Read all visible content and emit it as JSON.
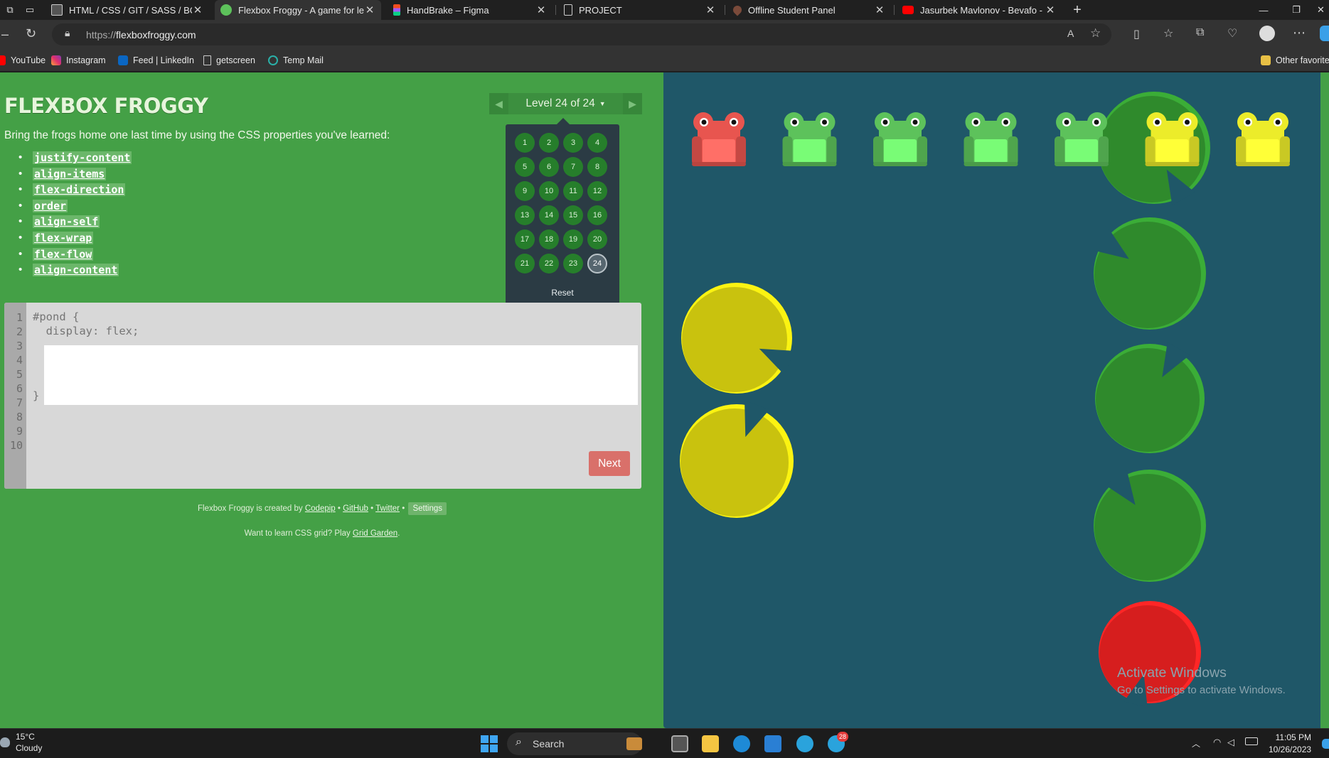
{
  "browser": {
    "tabs": [
      {
        "title": "HTML / CSS / GIT / SASS / BOOT",
        "icon": "notion-icon",
        "active": false
      },
      {
        "title": "Flexbox Froggy - A game for lear",
        "icon": "frog-icon",
        "active": true
      },
      {
        "title": "HandBrake – Figma",
        "icon": "figma-icon",
        "active": false
      },
      {
        "title": "PROJECT",
        "icon": "page-icon",
        "active": false
      },
      {
        "title": "Offline Student Panel",
        "icon": "heart-icon",
        "active": false
      },
      {
        "title": "Jasurbek Mavlonov - Bevafo - Yo",
        "icon": "youtube-icon",
        "active": false
      }
    ],
    "url_prefix": "https://",
    "url_host": "flexboxfroggy.com",
    "bookmarks": [
      {
        "label": "YouTube",
        "icon": "youtube-icon"
      },
      {
        "label": "Instagram",
        "icon": "instagram-icon"
      },
      {
        "label": "Feed | LinkedIn",
        "icon": "linkedin-icon"
      },
      {
        "label": "getscreen",
        "icon": "page-icon"
      },
      {
        "label": "Temp Mail",
        "icon": "mail-icon"
      },
      {
        "label": "Other favorite",
        "icon": "folder-icon"
      }
    ]
  },
  "game": {
    "title": "FLEXBOX FROGGY",
    "instructions": "Bring the frogs home one last time by using the CSS properties you've learned:",
    "properties": [
      "justify-content",
      "align-items",
      "flex-direction",
      "order",
      "align-self",
      "flex-wrap",
      "flex-flow",
      "align-content"
    ],
    "level_label": "Level 24 of 24",
    "levels": [
      "1",
      "2",
      "3",
      "4",
      "5",
      "6",
      "7",
      "8",
      "9",
      "10",
      "11",
      "12",
      "13",
      "14",
      "15",
      "16",
      "17",
      "18",
      "19",
      "20",
      "21",
      "22",
      "23",
      "24"
    ],
    "current_level": "24",
    "reset_label": "Reset",
    "line_numbers": [
      "1",
      "2",
      "3",
      "4",
      "5",
      "6",
      "7",
      "8",
      "9",
      "10"
    ],
    "code_line1": "#pond {",
    "code_line2": "  display: flex;",
    "code_line_close": "}",
    "next_label": "Next",
    "credits_prefix": "Flexbox Froggy is created by",
    "credit_codepip": "Codepip",
    "credit_github": "GitHub",
    "credit_twitter": "Twitter",
    "settings_label": "Settings",
    "grid_prefix": "Want to learn CSS grid? Play",
    "grid_link": "Grid Garden",
    "frogs": [
      "red",
      "green",
      "green",
      "green",
      "green",
      "yellow",
      "yellow"
    ],
    "lilypads": [
      "green",
      "green",
      "green",
      "green",
      "red",
      "yellow",
      "yellow"
    ]
  },
  "watermark": {
    "line1": "Activate Windows",
    "line2": "Go to Settings to activate Windows."
  },
  "taskbar": {
    "temperature": "15°C",
    "weather": "Cloudy",
    "search_label": "Search",
    "badge": "28",
    "time": "11:05 PM",
    "date": "10/26/2023"
  },
  "colors": {
    "page_green": "#44a046",
    "pond": "#1f5768",
    "frog_green": "#5dc25b",
    "frog_red": "#e8554f",
    "frog_yellow": "#ecec2a",
    "pad_green": "#2f8a2c",
    "pad_yellow": "#c9c20e",
    "pad_red": "#d61e1e"
  }
}
